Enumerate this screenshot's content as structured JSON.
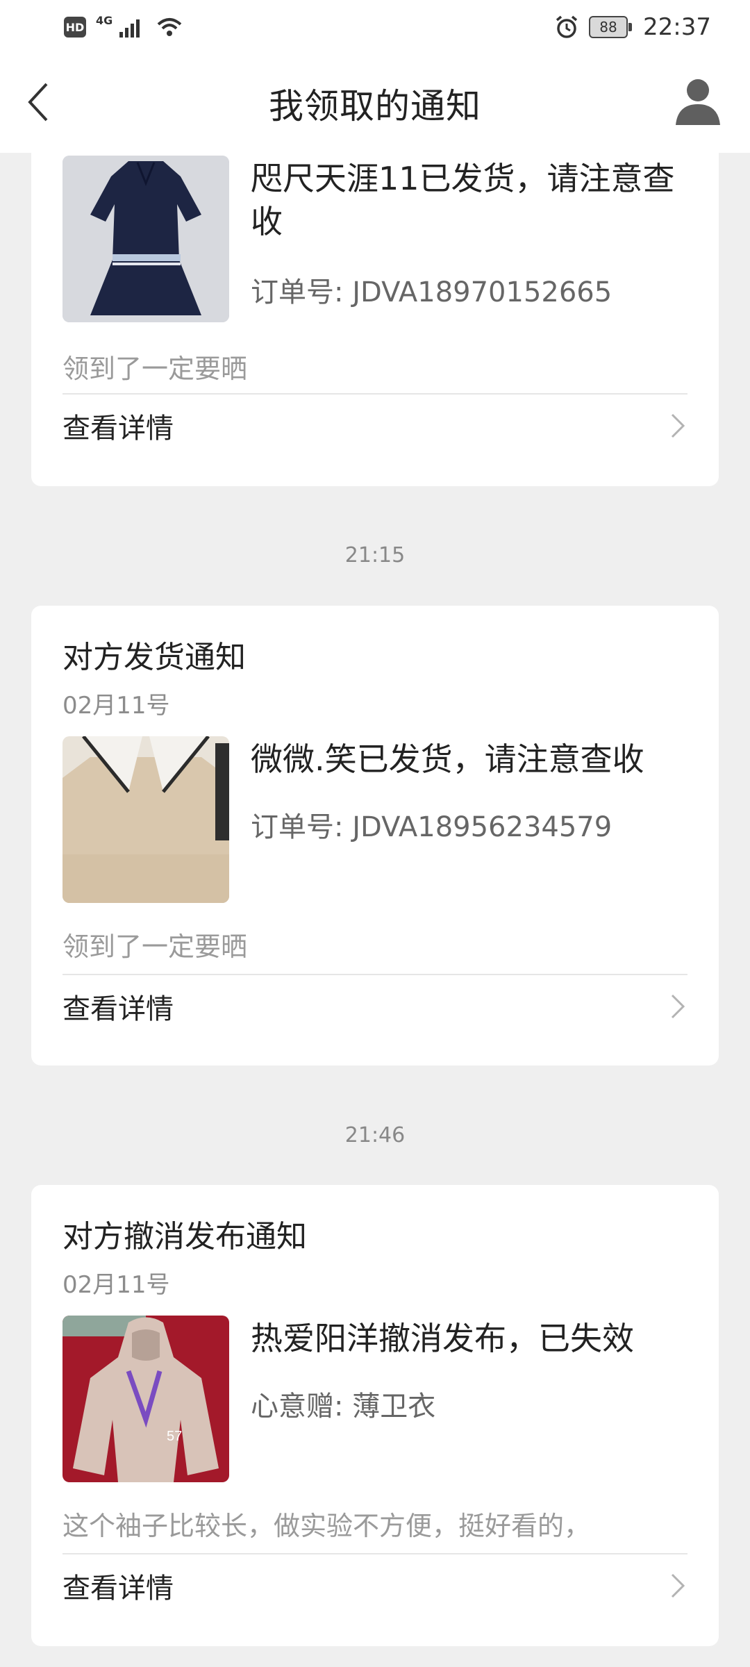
{
  "status_bar": {
    "network": "4G",
    "battery": "88",
    "time": "22:37"
  },
  "nav": {
    "title": "我领取的通知"
  },
  "cards": [
    {
      "message": "咫尺天涯11已发货，请注意查收",
      "order_label": "订单号: JDVA18970152665",
      "note": "领到了一定要晒",
      "detail_label": "查看详情"
    },
    {
      "title": "对方发货通知",
      "date": "02月11号",
      "message": "微微.笑已发货，请注意查收",
      "order_label": "订单号: JDVA18956234579",
      "note": "领到了一定要晒",
      "detail_label": "查看详情"
    },
    {
      "title": "对方撤消发布通知",
      "date": "02月11号",
      "message": "热爱阳洋撤消发布，已失效",
      "order_label": "心意赠: 薄卫衣",
      "note": "这个袖子比较长，做实验不方便，挺好看的，",
      "detail_label": "查看详情"
    }
  ],
  "timestamps": [
    "21:15",
    "21:46"
  ],
  "colors": {
    "background": "#efefef",
    "card": "#ffffff",
    "muted_text": "#8c8c8c"
  },
  "icons": [
    "back-icon",
    "profile-icon",
    "alarm-icon",
    "wifi-icon",
    "signal-icon",
    "chevron-right-icon"
  ]
}
